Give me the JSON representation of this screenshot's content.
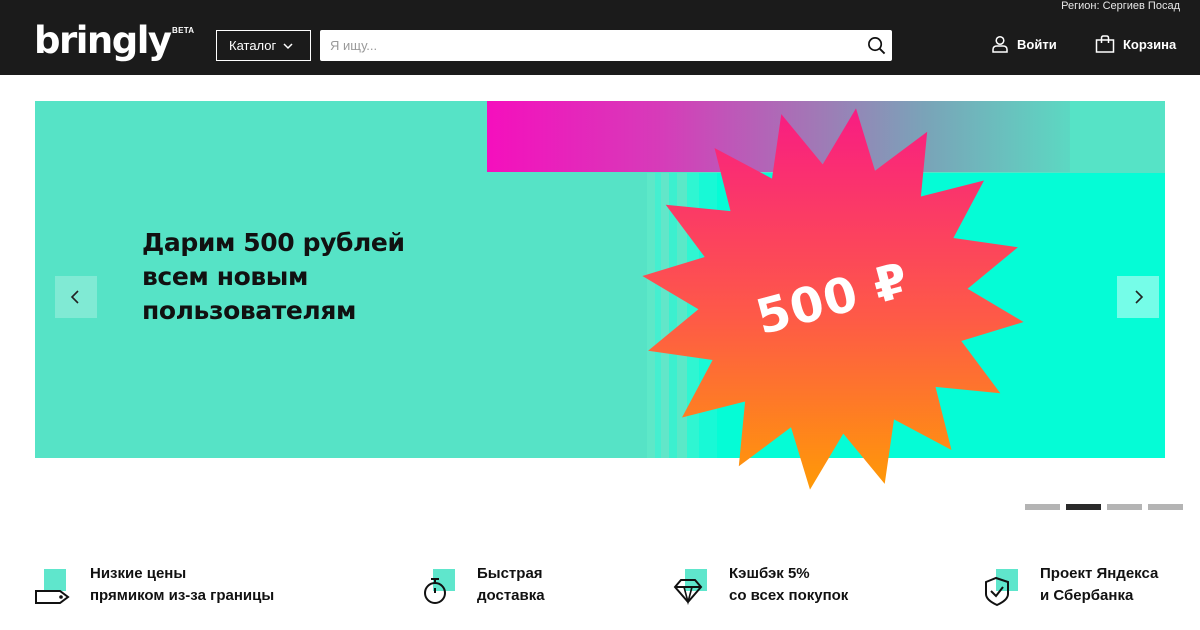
{
  "header": {
    "region": "Регион: Сергиев Посад",
    "logo": "bringly",
    "beta": "BETA",
    "catalog_label": "Каталог",
    "search_placeholder": "Я ищу...",
    "login_label": "Войти",
    "cart_label": "Корзина"
  },
  "banner": {
    "title": "Дарим 500 рублей всем новым пользователям",
    "price": "500 ₽",
    "colors": {
      "background": "#56e3c6",
      "accent_magenta": "#f50fbd",
      "star_top": "#f81c83",
      "star_bottom": "#ff9a06"
    },
    "slides_count": 4,
    "active_slide_index": 1
  },
  "features": [
    {
      "icon": "price-tag-icon",
      "line1": "Низкие цены",
      "line2": "прямиком из-за границы"
    },
    {
      "icon": "stopwatch-icon",
      "line1": "Быстрая",
      "line2": "доставка"
    },
    {
      "icon": "diamond-icon",
      "line1": "Кэшбэк 5%",
      "line2": "со всех покупок"
    },
    {
      "icon": "shield-check-icon",
      "line1": "Проект Яндекса",
      "line2": "и Сбербанка"
    }
  ]
}
